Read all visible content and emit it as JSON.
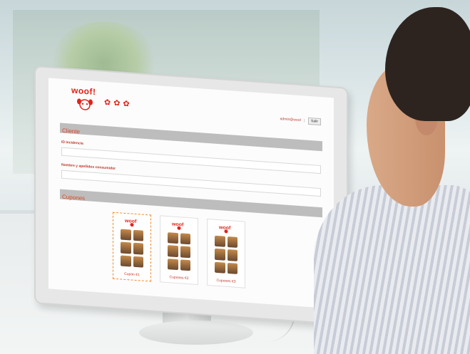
{
  "header": {
    "logo_text": "woof!",
    "user_link": "admin@woof",
    "exit_label": "Salir"
  },
  "sections": {
    "cliente_title": "Cliente",
    "cupones_title": "Cupones"
  },
  "form": {
    "incidencia_label": "ID Incidencia",
    "incidencia_value": "",
    "nombre_label": "Nombre y apellidos consumidor",
    "nombre_value": ""
  },
  "coupons": [
    {
      "label": "Cupón €1",
      "selected": true
    },
    {
      "label": "Cupones €2",
      "selected": false
    },
    {
      "label": "Cupones €3",
      "selected": false
    }
  ],
  "colors": {
    "brand_red": "#e2231a",
    "section_bar": "#bdbdbd",
    "selected_border": "#f08b2a"
  }
}
